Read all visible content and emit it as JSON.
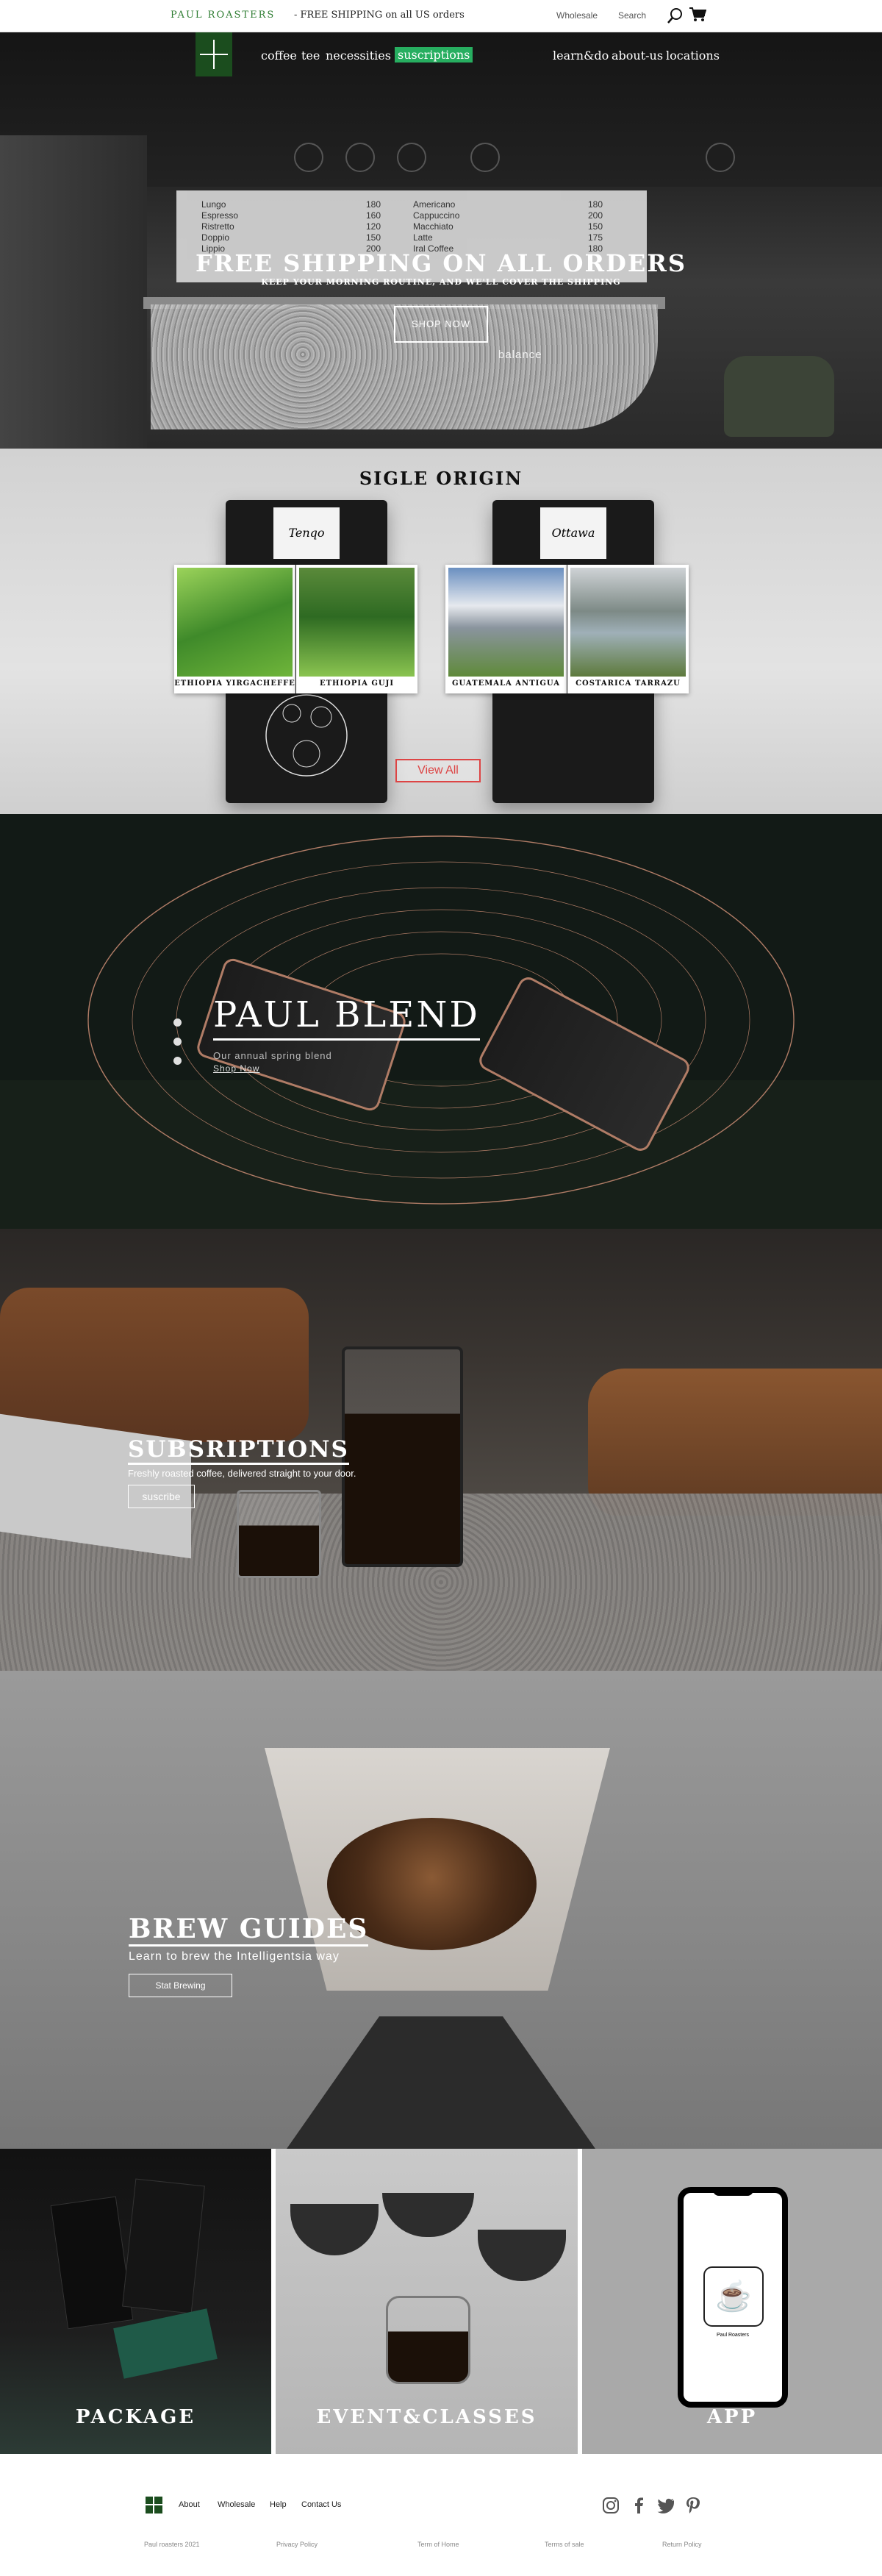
{
  "topbar": {
    "brand": "PAUL ROASTERS",
    "promo": "- FREE SHIPPING on all US orders",
    "wholesale": "Wholesale",
    "search": "Search",
    "icons": [
      "search-icon",
      "cart-icon"
    ]
  },
  "nav": {
    "left": [
      "coffee",
      "tee",
      "necessities",
      "suscriptions"
    ],
    "active": "suscriptions",
    "right": [
      "learn&do",
      "about-us",
      "locations"
    ],
    "active_color": "#27ae60"
  },
  "hero": {
    "title": "FREE SHIPPING ON ALL ORDERS",
    "subtitle": "KEEP YOUR MORNING ROUTINE, AND WE'LL COVER THE SHIPPING",
    "button": "SHOP NOW",
    "menu_left": [
      "Lungo",
      "Espresso",
      "Ristretto",
      "Doppio",
      "Lippio"
    ],
    "menu_left_prices": [
      "180",
      "160",
      "120",
      "150",
      "200"
    ],
    "menu_right": [
      "Americano",
      "Cappuccino",
      "Macchiato",
      "Latte",
      "Iral Coffee"
    ],
    "menu_right_prices": [
      "180",
      "200",
      "150",
      "175",
      "180"
    ],
    "sign": "balance"
  },
  "origin": {
    "heading": "SIGLE ORIGIN",
    "bag_labels": [
      "Tenqo",
      "Ottawa"
    ],
    "cards": [
      {
        "caption": "ETHIOPIA YIRGACHEFFE"
      },
      {
        "caption": "ETHIOPIA GUJI"
      },
      {
        "caption": "GUATEMALA ANTIGUA"
      },
      {
        "caption": "COSTARICA TARRAZU"
      }
    ],
    "button": "View All",
    "button_color": "#dd4444"
  },
  "blend": {
    "title": "PAUL BLEND",
    "subtitle": "Our annual spring blend",
    "link": "Shop Now",
    "accent": "#b07c66"
  },
  "subscriptions": {
    "title": "SUBSRIPTIONS",
    "subtitle": "Freshly roasted coffee, delivered straight to your door.",
    "button": "suscribe"
  },
  "brew": {
    "title": "BREW GUIDES",
    "subtitle": "Learn to brew the Intelligentsia way",
    "button": "Stat Brewing"
  },
  "tiles": {
    "package": "PACKAGE",
    "events": "EVENT&CLASSES",
    "app": "APP",
    "app_name": "Paul Roasters",
    "app_icon": "coffee-cup-icon"
  },
  "footer": {
    "links": [
      "About",
      "Wholesale",
      "Help",
      "Contact Us"
    ],
    "social": [
      "instagram-icon",
      "facebook-icon",
      "twitter-icon",
      "pinterest-icon"
    ],
    "legal": [
      "Paul roasters 2021",
      "Privacy Policy",
      "Term of Home",
      "Terms of sale",
      "Return Policy"
    ]
  }
}
